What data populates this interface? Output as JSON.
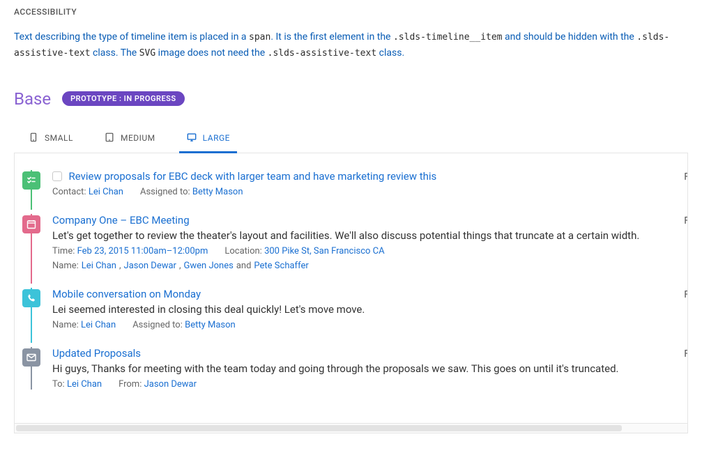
{
  "section_heading": "ACCESSIBILITY",
  "intro": {
    "p1a": "Text describing the type of timeline item is placed in a ",
    "c1": "span",
    "p1b": ". It is the first element in the ",
    "c2": ".slds-timeline__item",
    "p1c": " and should be hidden with the ",
    "c3": ".slds-assistive-text",
    "p1d": " class. The ",
    "c4": "SVG",
    "p1e": " image does not need the ",
    "c5": ".slds-assistive-text",
    "p1f": " class."
  },
  "variant": {
    "title": "Base",
    "badge": "PROTOTYPE : IN PROGRESS"
  },
  "tabs": {
    "small": "SMALL",
    "medium": "MEDIUM",
    "large": "LARGE"
  },
  "timeline": [
    {
      "kind": "task",
      "icon_bg": "#4bc076",
      "rail": "#4bc076",
      "title": "Review proposals for EBC deck with larger team and have marketing review this",
      "has_checkbox": true,
      "meta": [
        {
          "label": "Contact:",
          "link_text": "Lei Chan"
        },
        {
          "label": "Assigned to:",
          "link_text": "Betty Mason"
        }
      ],
      "right": "F"
    },
    {
      "kind": "event",
      "icon_bg": "#e36a8c",
      "rail": "#e36a8c",
      "title": "Company One – EBC Meeting",
      "desc": "Let's get together to review the theater's layout and facilities. We'll also discuss potential things that truncate at a certain width.",
      "meta": [
        {
          "label": "Time:",
          "link_text": "Feb 23, 2015 11:00am–12:00pm"
        },
        {
          "label": "Location:",
          "link_text": "300 Pike St, San Francisco CA"
        }
      ],
      "meta2": {
        "label": "Name:",
        "links": [
          "Lei Chan",
          "Jason Dewar",
          "Gwen Jones"
        ],
        "and": " and ",
        "last": "Pete Schaffer"
      },
      "right": "F"
    },
    {
      "kind": "call",
      "icon_bg": "#3cc3d9",
      "rail": "#3cc3d9",
      "title": "Mobile conversation on Monday",
      "desc": "Lei seemed interested in closing this deal quickly! Let's move move.",
      "meta": [
        {
          "label": "Name:",
          "link_text": "Lei Chan"
        },
        {
          "label": "Assigned to:",
          "link_text": "Betty Mason"
        }
      ],
      "right": "F"
    },
    {
      "kind": "email",
      "icon_bg": "#8a94a3",
      "rail": "#8a94a3",
      "title": "Updated Proposals",
      "desc": "Hi guys, Thanks for meeting with the team today and going through the proposals we saw. This goes on until it's truncated.",
      "meta": [
        {
          "label": "To:",
          "link_text": "Lei Chan"
        },
        {
          "label": "From:",
          "link_text": "Jason Dewar"
        }
      ],
      "right": "F"
    }
  ]
}
